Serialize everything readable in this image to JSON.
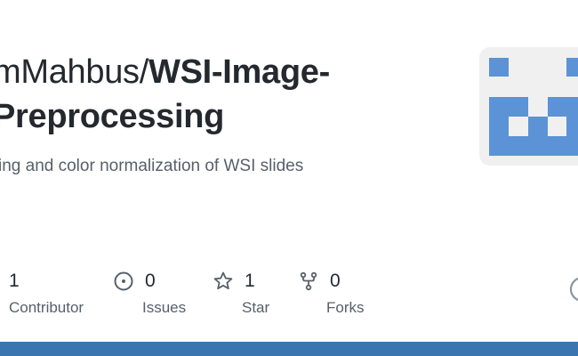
{
  "repo": {
    "owner": "mMahbus",
    "separator": "/",
    "name_part1": "WSI-Image-",
    "name_part2": "Preprocessing",
    "description": "ing and color normalization of WSI slides"
  },
  "stats": [
    {
      "icon": "people-icon",
      "count": "1",
      "label": "Contributor"
    },
    {
      "icon": "issue-opened-icon",
      "count": "0",
      "label": "Issues"
    },
    {
      "icon": "star-icon",
      "count": "1",
      "label": "Star"
    },
    {
      "icon": "repo-forked-icon",
      "count": "0",
      "label": "Forks"
    }
  ],
  "colors": {
    "accent_bar": "#3a75b0",
    "avatar_fg": "#5b93d6",
    "avatar_bg": "#f0f0f0",
    "muted_text": "#57606a"
  }
}
